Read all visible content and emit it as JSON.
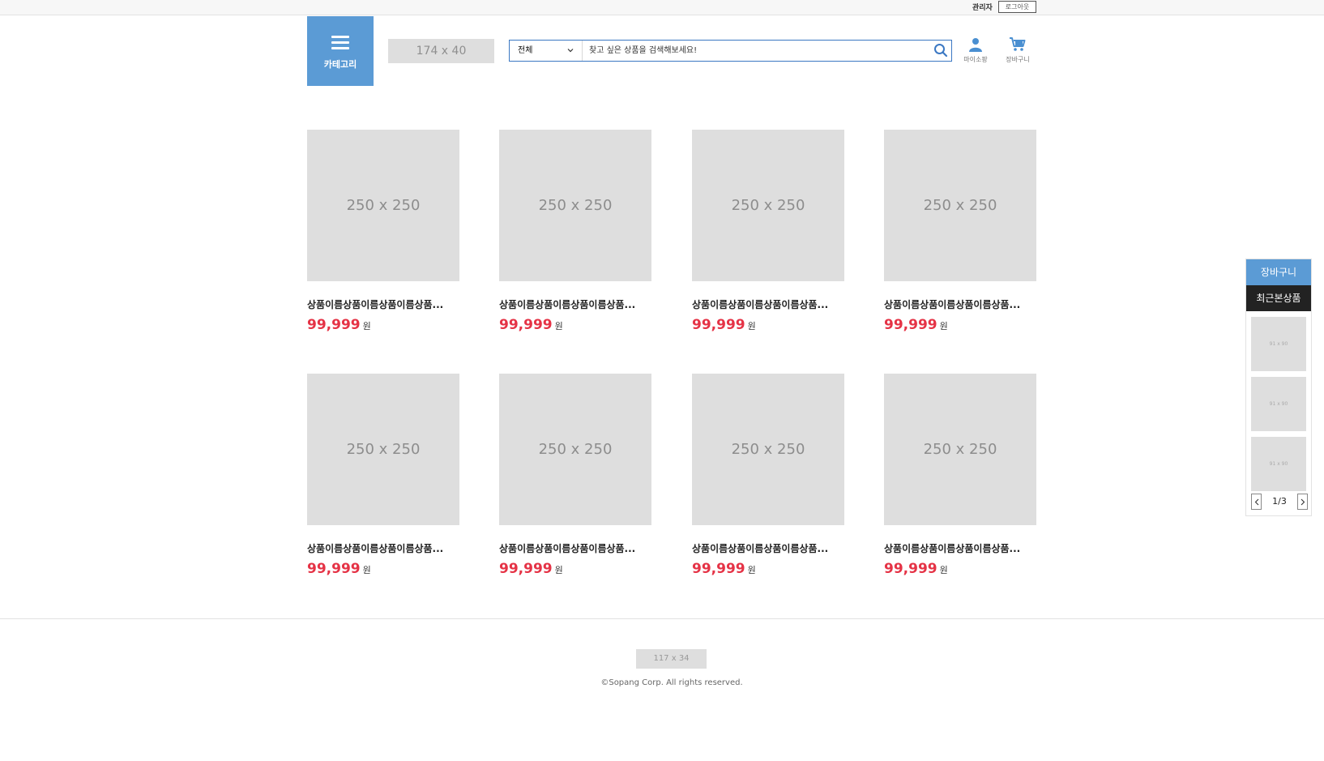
{
  "topbar": {
    "admin_label": "관리자",
    "logout_label": "로그아웃"
  },
  "header": {
    "category_label": "카테고리",
    "logo_placeholder": "174 x 40",
    "search": {
      "selected_option": "전체",
      "placeholder": "찾고 싶은 상품을 검색해보세요!"
    },
    "mypage_label": "마이소팡",
    "cart_label": "장바구니"
  },
  "products": [
    {
      "image": "250 x 250",
      "name": "상품이름상품이름상품이름상품...",
      "price": "99,999",
      "currency": "원"
    },
    {
      "image": "250 x 250",
      "name": "상품이름상품이름상품이름상품...",
      "price": "99,999",
      "currency": "원"
    },
    {
      "image": "250 x 250",
      "name": "상품이름상품이름상품이름상품...",
      "price": "99,999",
      "currency": "원"
    },
    {
      "image": "250 x 250",
      "name": "상품이름상품이름상품이름상품...",
      "price": "99,999",
      "currency": "원"
    },
    {
      "image": "250 x 250",
      "name": "상품이름상품이름상품이름상품...",
      "price": "99,999",
      "currency": "원"
    },
    {
      "image": "250 x 250",
      "name": "상품이름상품이름상품이름상품...",
      "price": "99,999",
      "currency": "원"
    },
    {
      "image": "250 x 250",
      "name": "상품이름상품이름상품이름상품...",
      "price": "99,999",
      "currency": "원"
    },
    {
      "image": "250 x 250",
      "name": "상품이름상품이름상품이름상품...",
      "price": "99,999",
      "currency": "원"
    }
  ],
  "side": {
    "cart_tab": "장바구니",
    "recent_tab": "최근본상품",
    "thumbs": [
      "91 x 90",
      "91 x 90",
      "91 x 90"
    ],
    "page_text": "1/3"
  },
  "footer": {
    "logo_placeholder": "117 x 34",
    "copyright": "©Sopang Corp. All rights reserved."
  },
  "colors": {
    "accent": "#5b9bd5",
    "price": "#e53346",
    "search_border": "#3b78c3",
    "dark_tab": "#222222"
  }
}
